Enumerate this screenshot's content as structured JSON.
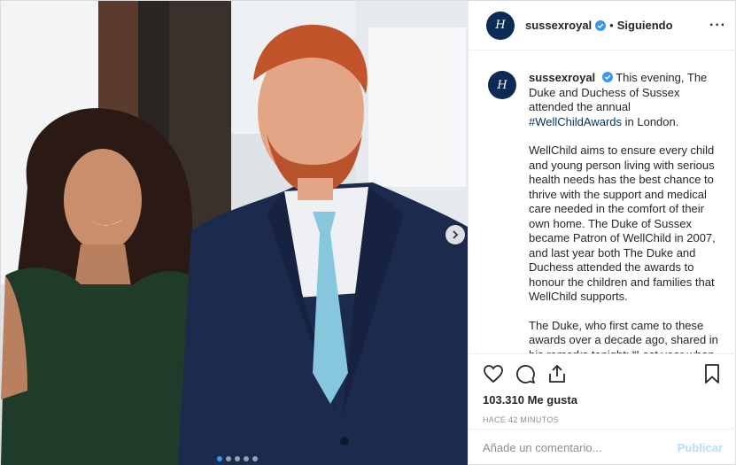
{
  "post": {
    "username": "sussexroyal",
    "separator": "•",
    "follow_status": "Siguiendo",
    "more_icon": "···",
    "avatar_monogram": "H",
    "caption_paragraphs": [
      "This evening, The Duke and Duchess of Sussex attended the annual ",
      "WellChild aims to ensure every child and young person living with serious health needs has the best chance to thrive with the support and medical care needed in the comfort of their own home. The Duke of Sussex became Patron of WellChild in 2007, and last year both The Duke and Duchess attended the awards to honour the children and families that WellChild supports.",
      "The Duke, who first came to these awards over a decade ago, shared in his remarks tonight: “Last year when my wife and I attended we knew we"
    ],
    "hashtag": "#WellChildAwards",
    "caption_tail": " in London.",
    "likes": "103.310 Me gusta",
    "time_ago": "HACE 42 MINUTOS",
    "comment_placeholder": "Añade un comentario...",
    "publish_label": "Publicar",
    "carousel": {
      "count": 5,
      "active_index": 0
    }
  },
  "colors": {
    "verified": "#3897f0",
    "hashtag": "#003569",
    "publish_disabled": "#b2dffc",
    "avatar_bg": "#0b2a55"
  },
  "icons": [
    "verified-badge-icon",
    "more-options-icon",
    "heart-icon",
    "comment-icon",
    "share-icon",
    "bookmark-icon",
    "chevron-right-icon"
  ]
}
